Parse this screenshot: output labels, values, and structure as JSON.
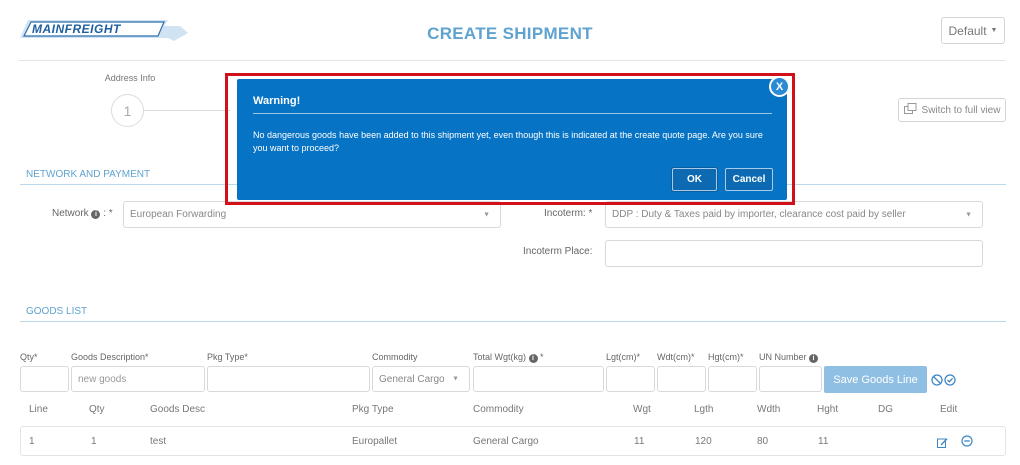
{
  "header": {
    "logo_text": "MAINFREIGHT",
    "title": "CREATE SHIPMENT",
    "profile_select": "Default"
  },
  "stepper": {
    "step_label": "Address Info",
    "step_number": "1",
    "full_view_label": "Switch to full view"
  },
  "network_payment": {
    "section_title": "NETWORK AND PAYMENT",
    "network_label": "Network",
    "network_value": "European Forwarding",
    "incoterm_label": "Incoterm: *",
    "incoterm_value": "DDP : Duty & Taxes paid by importer, clearance cost paid by seller",
    "incoterm_place_label": "Incoterm Place:",
    "incoterm_place_value": ""
  },
  "goods": {
    "section_title": "GOODS LIST",
    "input_labels": {
      "qty": "Qty*",
      "desc": "Goods Description*",
      "pkg": "Pkg Type*",
      "commodity": "Commodity",
      "total_wgt": "Total Wgt(kg)",
      "lgt": "Lgt(cm)*",
      "wdt": "Wdt(cm)*",
      "hgt": "Hgt(cm)*",
      "un": "UN Number"
    },
    "inputs": {
      "qty": "",
      "desc_placeholder": "new goods",
      "pkg": "",
      "commodity": "General Cargo",
      "total_wgt": "",
      "lgt": "",
      "wdt": "",
      "hgt": "",
      "un": ""
    },
    "save_label": "Save Goods Line",
    "columns": [
      "Line",
      "Qty",
      "Goods Desc",
      "Pkg Type",
      "Commodity",
      "Wgt",
      "Lgth",
      "Wdth",
      "Hght",
      "DG",
      "Edit"
    ],
    "rows": [
      {
        "line": "1",
        "qty": "1",
        "desc": "test",
        "pkg": "Europallet",
        "commodity": "General Cargo",
        "wgt": "11",
        "lgth": "120",
        "wdth": "80",
        "hght": "11",
        "dg": ""
      }
    ]
  },
  "dialog": {
    "title": "Warning!",
    "message": "No dangerous goods have been added to this shipment yet, even though this is indicated at the create quote page. Are you sure you want to proceed?",
    "close_label": "X",
    "ok_label": "OK",
    "cancel_label": "Cancel"
  },
  "colors": {
    "accent": "#5fa3d0",
    "dialog_bg": "#0773c4",
    "highlight_frame": "#d1111a",
    "save_button": "#8fbfe3"
  },
  "icons": [
    "info-icon",
    "caret-down-icon",
    "window-restore-icon",
    "ban-icon",
    "check-circle-icon",
    "edit-icon",
    "remove-circle-icon",
    "close-icon"
  ]
}
